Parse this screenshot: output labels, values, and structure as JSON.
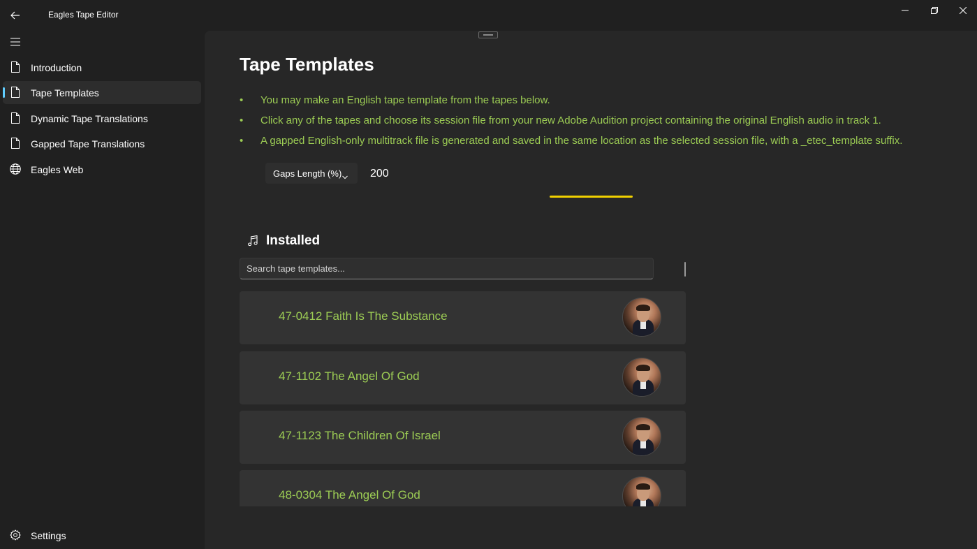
{
  "window": {
    "title": "Eagles Tape Editor",
    "back_icon": "back-arrow-icon",
    "controls": [
      "minimize-icon",
      "restore-icon",
      "close-icon"
    ]
  },
  "sidebar": {
    "menu_icon": "hamburger-menu-icon",
    "items": [
      {
        "label": "Introduction",
        "icon": "document-icon",
        "selected": false
      },
      {
        "label": "Tape Templates",
        "icon": "document-icon",
        "selected": true
      },
      {
        "label": "Dynamic Tape Translations",
        "icon": "document-icon",
        "selected": false
      },
      {
        "label": "Gapped Tape Translations",
        "icon": "document-icon",
        "selected": false
      },
      {
        "label": "Eagles Web",
        "icon": "globe-icon",
        "selected": false
      }
    ],
    "settings": {
      "label": "Settings",
      "icon": "gear-icon"
    }
  },
  "main": {
    "title": "Tape Templates",
    "bullets": [
      "You may make an English tape template from the tapes below.",
      "Click any of the tapes and choose its session file from your new Adobe Audition project containing the original English audio in track 1.",
      "A gapped English-only multitrack file is generated and saved in the same location as the selected session file, with a _etec_template suffix."
    ],
    "bullet_char": "•",
    "gaps": {
      "label": "Gaps Length (%)",
      "value": "200"
    },
    "installed": {
      "label": "Installed",
      "icon": "music-note-icon"
    },
    "search": {
      "placeholder": "Search tape templates...",
      "value": ""
    },
    "tapes": [
      {
        "title": "47-0412 Faith Is The Substance"
      },
      {
        "title": "47-1102 The Angel Of God"
      },
      {
        "title": "47-1123 The Children Of Israel"
      },
      {
        "title": "48-0304 The Angel Of God"
      }
    ]
  },
  "colors": {
    "accent": "#60cdff",
    "bullet_text": "#9ccc54",
    "progress": "#f0d000",
    "background": "#202020",
    "content": "#272727"
  }
}
